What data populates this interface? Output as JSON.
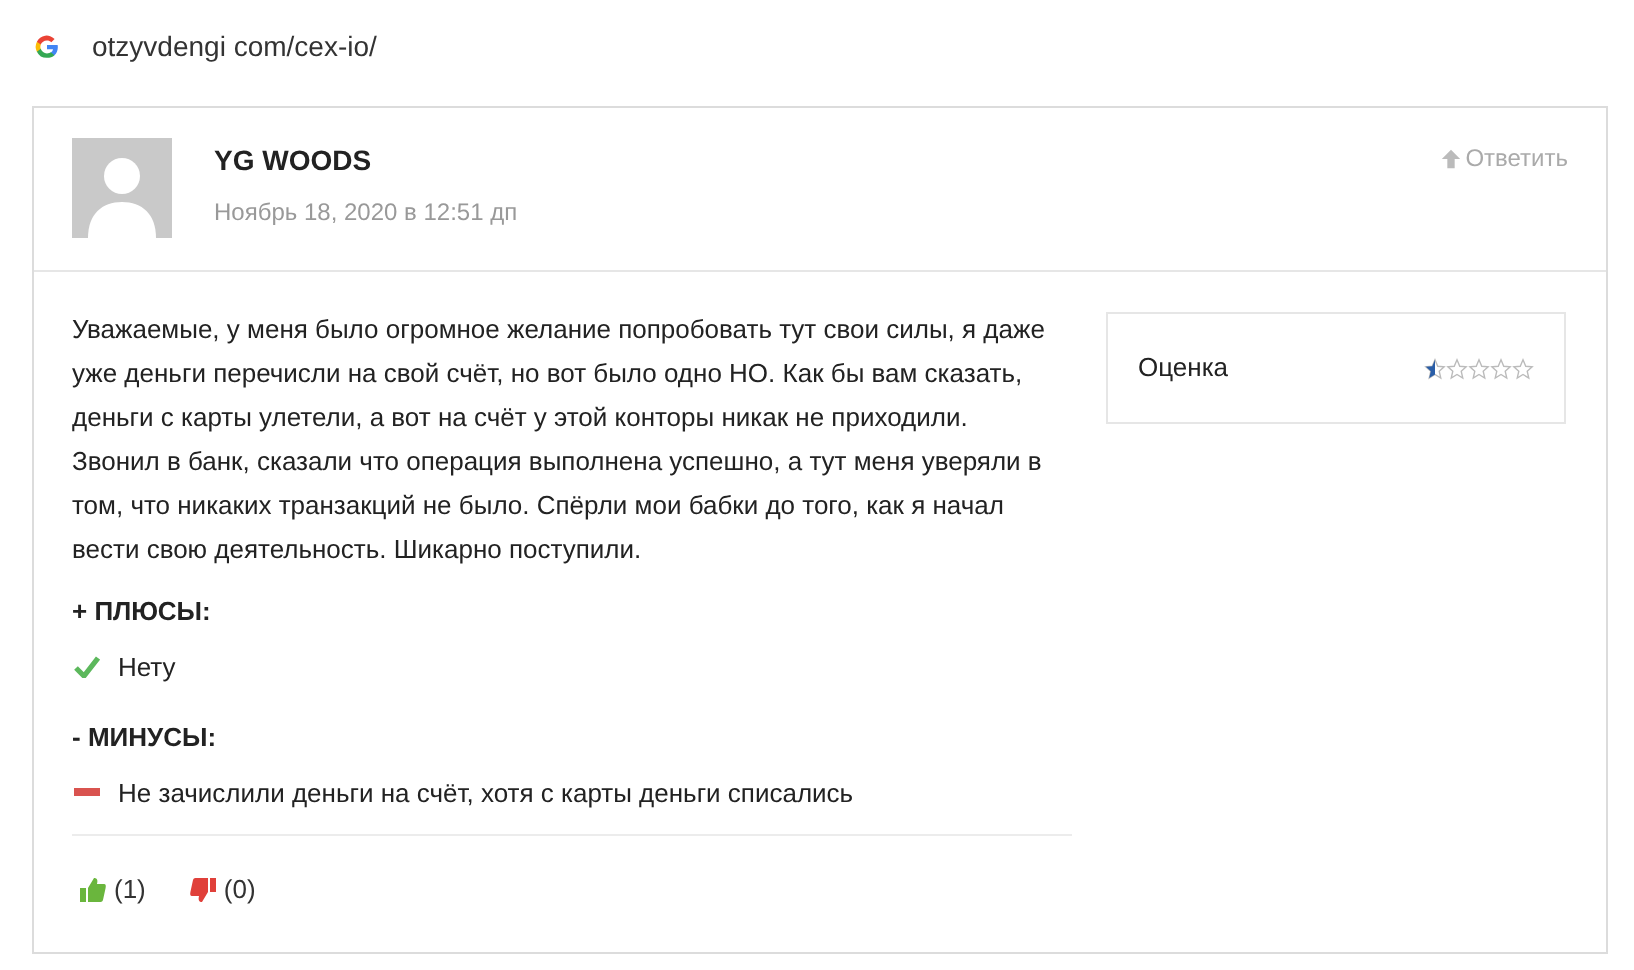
{
  "address_bar": {
    "url": "otzyvdengi com/cex-io/"
  },
  "review": {
    "author": "YG WOODS",
    "date": "Ноябрь 18, 2020 в 12:51 дп",
    "reply": "Ответить",
    "text": "Уважаемые, у меня было огромное желание попробовать тут свои силы, я даже уже деньги перечисли на свой счёт, но вот было одно НО. Как бы вам сказать, деньги с карты улетели, а вот на счёт у этой конторы никак не приходили. Звонил в банк, сказали что операция выполнена успешно, а тут меня уверяли в том, что никаких транзакций не было. Спёрли мои бабки до того, как я начал вести свою деятельность. Шикарно поступили.",
    "sections": [
      {
        "kind": "pros",
        "heading": "+ ПЛЮСЫ:",
        "items": [
          "Нету"
        ]
      },
      {
        "kind": "cons",
        "heading": "- МИНУСЫ:",
        "items": [
          "Не зачислили деньги на счёт, хотя с карты деньги списались"
        ]
      }
    ],
    "votes": {
      "likes": "(1)",
      "dislikes": "(0)"
    },
    "rating": {
      "label": "Оценка",
      "stars": 0.5
    }
  }
}
